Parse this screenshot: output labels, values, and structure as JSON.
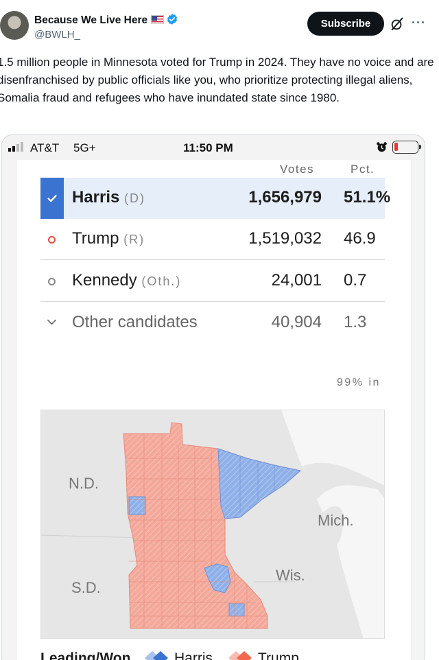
{
  "tweet": {
    "author_name": "Because We Live Here",
    "author_handle": "@BWLH_",
    "subscribe_label": "Subscribe",
    "text": "1.5 million people in Minnesota voted for Trump in 2024. They have no voice and are disenfranchised by public officials like you, who prioritize protecting illegal aliens, Somalia fraud and refugees who have inundated state since 1980.",
    "icons": [
      "verified-badge-icon",
      "grok-icon",
      "more-icon",
      "us-flag-icon"
    ]
  },
  "phone_status": {
    "carrier": "AT&T",
    "network": "5G+",
    "time": "11:50 PM",
    "battery_level": 0.15,
    "icons": [
      "signal-icon",
      "alarm-icon",
      "battery-icon"
    ]
  },
  "results": {
    "headers": {
      "votes": "Votes",
      "pct": "Pct."
    },
    "candidates": [
      {
        "name": "Harris",
        "party": "(D)",
        "votes": "1,656,979",
        "pct": "51.1%",
        "winner": true
      },
      {
        "name": "Trump",
        "party": "(R)",
        "votes": "1,519,032",
        "pct": "46.9",
        "winner": false
      },
      {
        "name": "Kennedy",
        "party": "(Oth.)",
        "votes": "24,001",
        "pct": "0.7",
        "winner": false
      },
      {
        "name": "Other candidates",
        "party": "",
        "votes": "40,904",
        "pct": "1.3",
        "winner": false
      }
    ],
    "reporting": "99% in"
  },
  "map": {
    "labels": {
      "nd": "N.D.",
      "sd": "S.D.",
      "wis": "Wis.",
      "mich": "Mich."
    },
    "colors": {
      "harris": "#8fb0e8",
      "trump": "#f4a89a",
      "land": "#e4e4e4",
      "water": "#f4f4f4"
    }
  },
  "legend": {
    "title": "Leading/Won",
    "harris_label": "Harris",
    "trump_label": "Trump",
    "colors": {
      "harris": "#3b74d0",
      "trump": "#f2684f"
    }
  }
}
